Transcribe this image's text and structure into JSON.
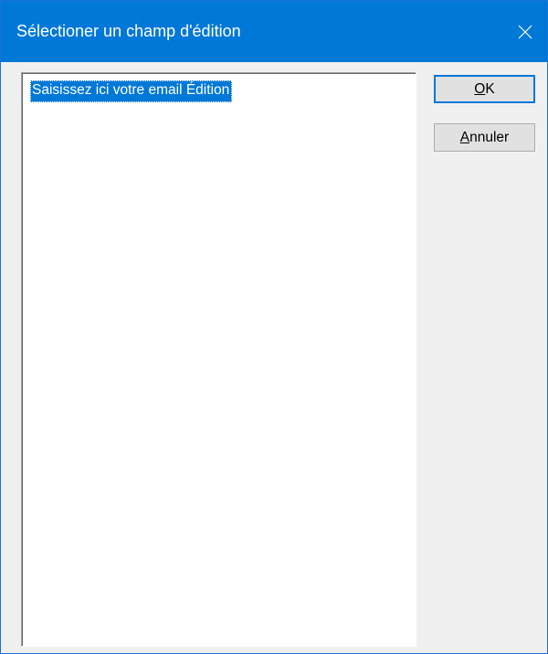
{
  "dialog": {
    "title": "Sélectioner un champ d'édition",
    "close_icon": "close-icon"
  },
  "list": {
    "items": [
      {
        "label": "Saisissez ici votre email Édition",
        "selected": true
      }
    ]
  },
  "buttons": {
    "ok": {
      "mnemonic": "O",
      "rest": "K"
    },
    "cancel": {
      "mnemonic": "A",
      "rest": "nnuler"
    }
  },
  "colors": {
    "titlebar": "#0078d7",
    "selection": "#0078d7",
    "dialog_background": "#f0f0f0",
    "button_face": "#e1e1e1"
  }
}
